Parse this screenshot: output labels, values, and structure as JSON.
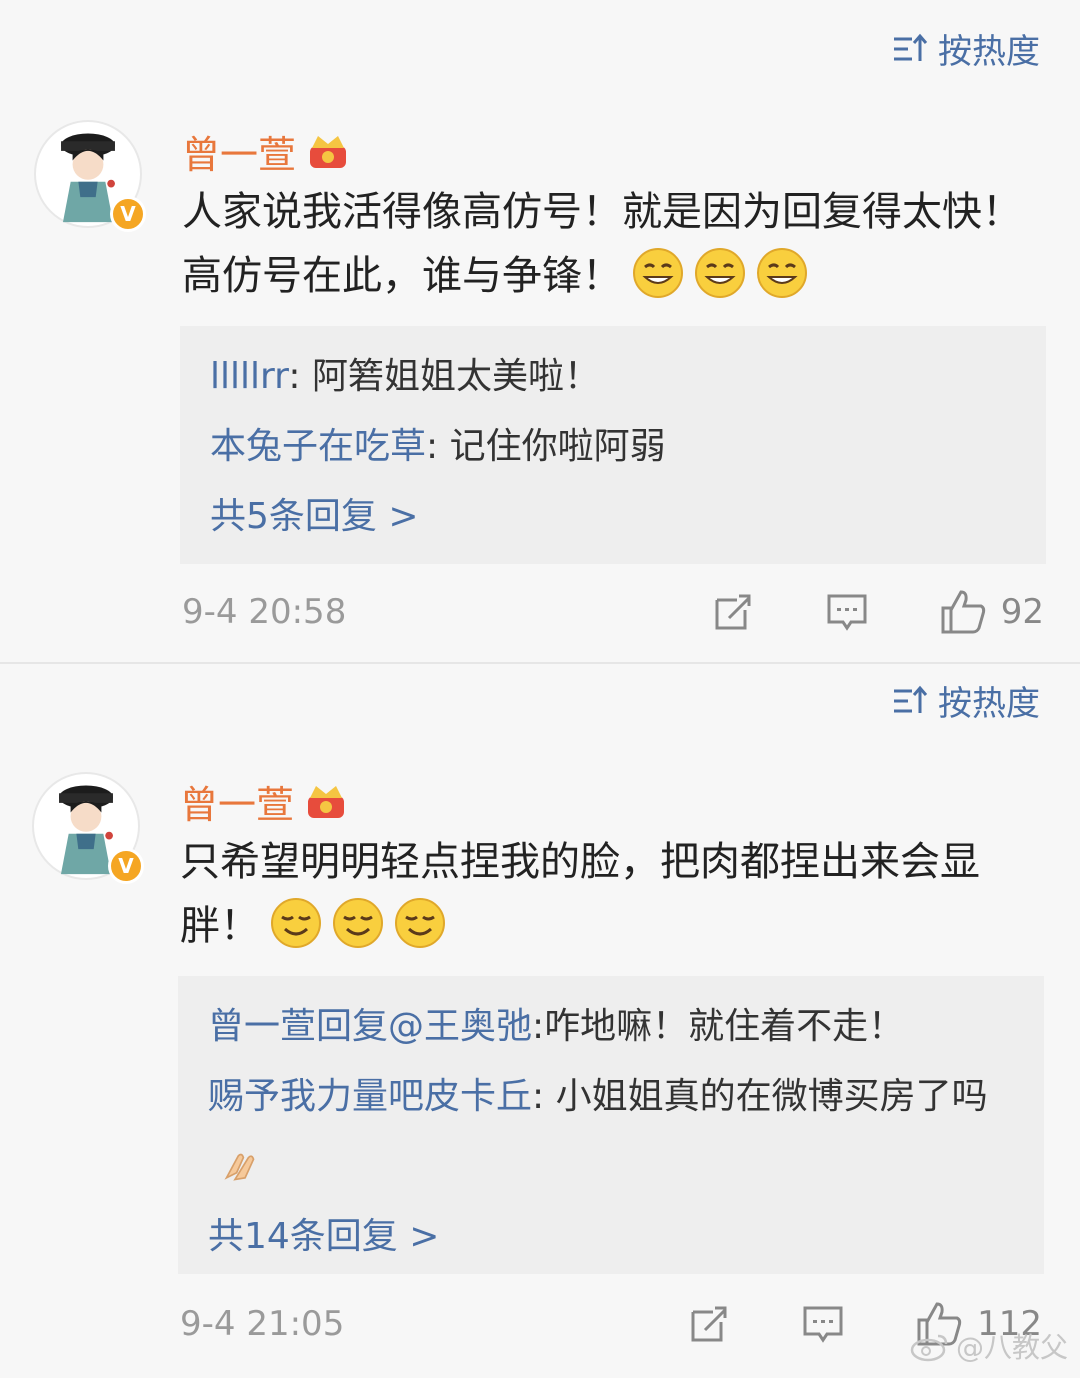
{
  "comments": [
    {
      "sort_label": "按热度",
      "username": "曾一萱",
      "badge": "V",
      "text": "人家说我活得像高仿号！就是因为回复得太快！高仿号在此，谁与争锋！",
      "emoji_count": 3,
      "replies": [
        {
          "user": "lllllrr",
          "sep": ": ",
          "text": "阿箬姐姐太美啦！"
        },
        {
          "user": "本兔子在吃草",
          "sep": ": ",
          "text": "记住你啦阿弱"
        }
      ],
      "more_label": "共5条回复 >",
      "timestamp": "9-4 20:58",
      "likes": "92"
    },
    {
      "sort_label": "按热度",
      "username": "曾一萱",
      "badge": "V",
      "text": "只希望明明轻点捏我的脸，把肉都捏出来会显胖！",
      "emoji_count": 3,
      "replies": [
        {
          "user": "曾一萱回复@王奥弛",
          "sep": ":",
          "text": "咋地嘛！就住着不走！"
        },
        {
          "user": "赐予我力量吧皮卡丘",
          "sep": ": ",
          "text": "小姐姐真的在微博买房了吗"
        }
      ],
      "more_label": "共14条回复 >",
      "timestamp": "9-4 21:05",
      "likes": "112"
    }
  ],
  "watermark": "@八教父",
  "colors": {
    "link": "#4a6fa5",
    "username": "#e8773c",
    "badge": "#f5a623",
    "reply_bg": "#eeeeee"
  }
}
